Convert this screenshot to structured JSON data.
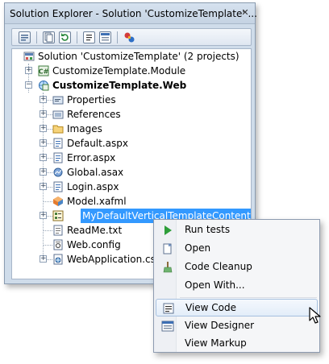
{
  "window": {
    "title": "Solution Explorer - Solution 'CustomizeTemplate' ...",
    "close_glyph": "✕"
  },
  "toolbar": {
    "buttons": [
      {
        "name": "properties-icon"
      },
      {
        "name": "show-all-files-icon"
      },
      {
        "name": "refresh-icon"
      },
      {
        "name": "view-code-icon"
      },
      {
        "name": "view-designer-icon"
      },
      {
        "name": "class-diagram-icon"
      }
    ]
  },
  "tree": {
    "solution": "Solution 'CustomizeTemplate' (2 projects)",
    "module_project": "CustomizeTemplate.Module",
    "web_project": "CustomizeTemplate.Web",
    "items": [
      {
        "label": "Properties",
        "icon": "properties-folder-icon",
        "expandable": true
      },
      {
        "label": "References",
        "icon": "references-icon",
        "expandable": true
      },
      {
        "label": "Images",
        "icon": "folder-icon",
        "expandable": true
      },
      {
        "label": "Default.aspx",
        "icon": "aspx-page-icon",
        "expandable": true
      },
      {
        "label": "Error.aspx",
        "icon": "aspx-page-icon",
        "expandable": true
      },
      {
        "label": "Global.asax",
        "icon": "global-asax-icon",
        "expandable": true
      },
      {
        "label": "Login.aspx",
        "icon": "aspx-page-icon",
        "expandable": true
      },
      {
        "label": "Model.xafml",
        "icon": "model-icon",
        "expandable": false
      },
      {
        "label": "MyDefaultVerticalTemplateContent.ascx",
        "icon": "user-control-icon",
        "expandable": true,
        "selected": true
      },
      {
        "label": "ReadMe.txt",
        "icon": "text-file-icon",
        "expandable": false
      },
      {
        "label": "Web.config",
        "icon": "config-file-icon",
        "expandable": false
      },
      {
        "label": "WebApplication.cs",
        "icon": "cs-file-icon",
        "expandable": true
      }
    ]
  },
  "context_menu": {
    "items": [
      {
        "label": "Run tests",
        "icon": "run-tests-icon"
      },
      {
        "label": "Open",
        "icon": "open-icon"
      },
      {
        "label": "Code Cleanup",
        "icon": "code-cleanup-icon"
      },
      {
        "label": "Open With...",
        "icon": ""
      },
      {
        "label": "View Code",
        "icon": "view-code-icon",
        "hover": true
      },
      {
        "label": "View Designer",
        "icon": "view-designer-icon"
      },
      {
        "label": "View Markup",
        "icon": ""
      }
    ]
  },
  "colors": {
    "selection": "#3399ff",
    "window_frame": "#cfdcea",
    "run_tests_green": "#2e9e3a"
  }
}
